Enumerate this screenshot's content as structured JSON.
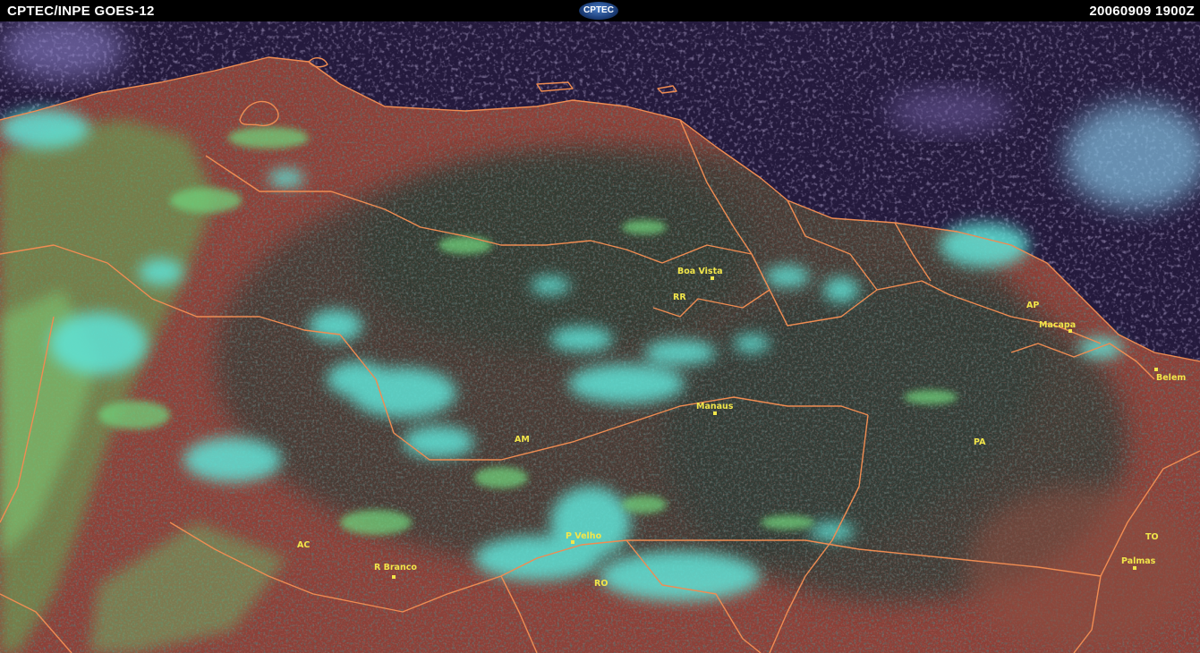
{
  "header": {
    "left_title": "CPTEC/INPE  GOES-12",
    "logo_text": "CPTEC",
    "timestamp": "20060909  1900Z"
  },
  "colors": {
    "ocean": "#241a3d",
    "land": "#8c4038",
    "forest": "#26322e",
    "cloud_cyan": "#5fe3d7",
    "cloud_green": "#6fd27a",
    "border": "#f08c52",
    "label": "#f2e64a"
  },
  "cities": {
    "boa_vista": "Boa Vista",
    "macapa": "Macapa",
    "belem": "Belem",
    "manaus": "Manaus",
    "p_velho": "P Velho",
    "r_branco": "R Branco",
    "palmas": "Palmas"
  },
  "states": {
    "rr": "RR",
    "ap": "AP",
    "am": "AM",
    "pa": "PA",
    "ac": "AC",
    "ro": "RO",
    "to": "TO"
  }
}
